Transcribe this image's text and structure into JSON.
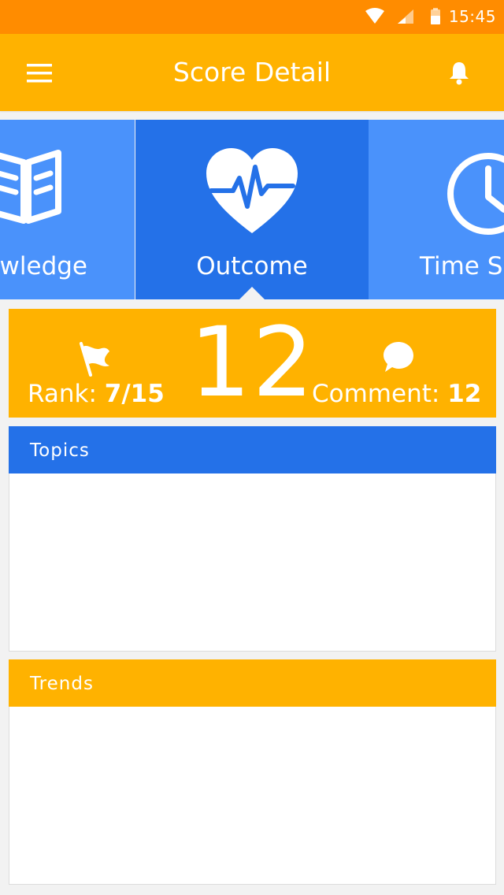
{
  "status_bar": {
    "time": "15:45",
    "icons": [
      "wifi-icon",
      "signal-icon",
      "battery-icon"
    ]
  },
  "app_bar": {
    "title": "Score Detail",
    "menu_icon": "menu-icon",
    "notification_icon": "bell-icon"
  },
  "tabs": [
    {
      "label": "Knowledge",
      "visible_label": "wledge",
      "icon": "book-icon",
      "selected": false
    },
    {
      "label": "Outcome",
      "visible_label": "Outcome",
      "icon": "heart-pulse-icon",
      "selected": true
    },
    {
      "label": "Time Spent",
      "visible_label": "Time S",
      "icon": "clock-icon",
      "selected": false
    }
  ],
  "score_card": {
    "score": "12",
    "rank_label": "Rank:",
    "rank_value": "7/15",
    "comment_label": "Comment:",
    "comment_value": "12"
  },
  "panels": {
    "topics": {
      "title": "Topics"
    },
    "trends": {
      "title": "Trends"
    }
  },
  "colors": {
    "status_bar": "#ff8c00",
    "app_bar": "#ffb200",
    "tab_selected": "#2471e8",
    "tab_default": "#4a92fb",
    "background": "#f2f2f2"
  }
}
